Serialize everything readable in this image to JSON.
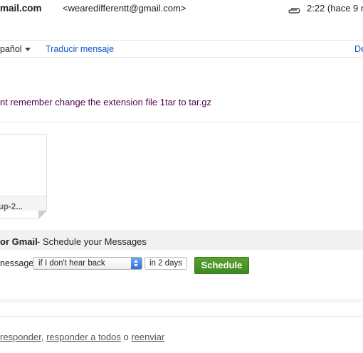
{
  "header": {
    "sender_email": "mail.com",
    "sender_address": "<wearedifferentt@gmail.com>",
    "time": "2:22 (hace 9 m"
  },
  "language_bar": {
    "language": "pañol",
    "translate_link": "Traducir mensaje",
    "right_link": "De"
  },
  "message": {
    "body": "nt remember change the extension file 1tar to tar.gz"
  },
  "attachment": {
    "name": "up-2..."
  },
  "schedule": {
    "title_strong": "or Gmail",
    "title_rest": " - Schedule your Messages",
    "prefix": "nessage",
    "condition_value": "if I don't hear back",
    "days_value": "in 2 days",
    "button_label": "Schedule"
  },
  "reply": {
    "responder": "responder",
    "comma": ",",
    "reply_all": "responder a todos",
    "or": "o",
    "forward": "reenviar"
  },
  "colors": {
    "link": "#1155cc",
    "body_text": "#500050",
    "schedule_button": "#4a9525"
  }
}
